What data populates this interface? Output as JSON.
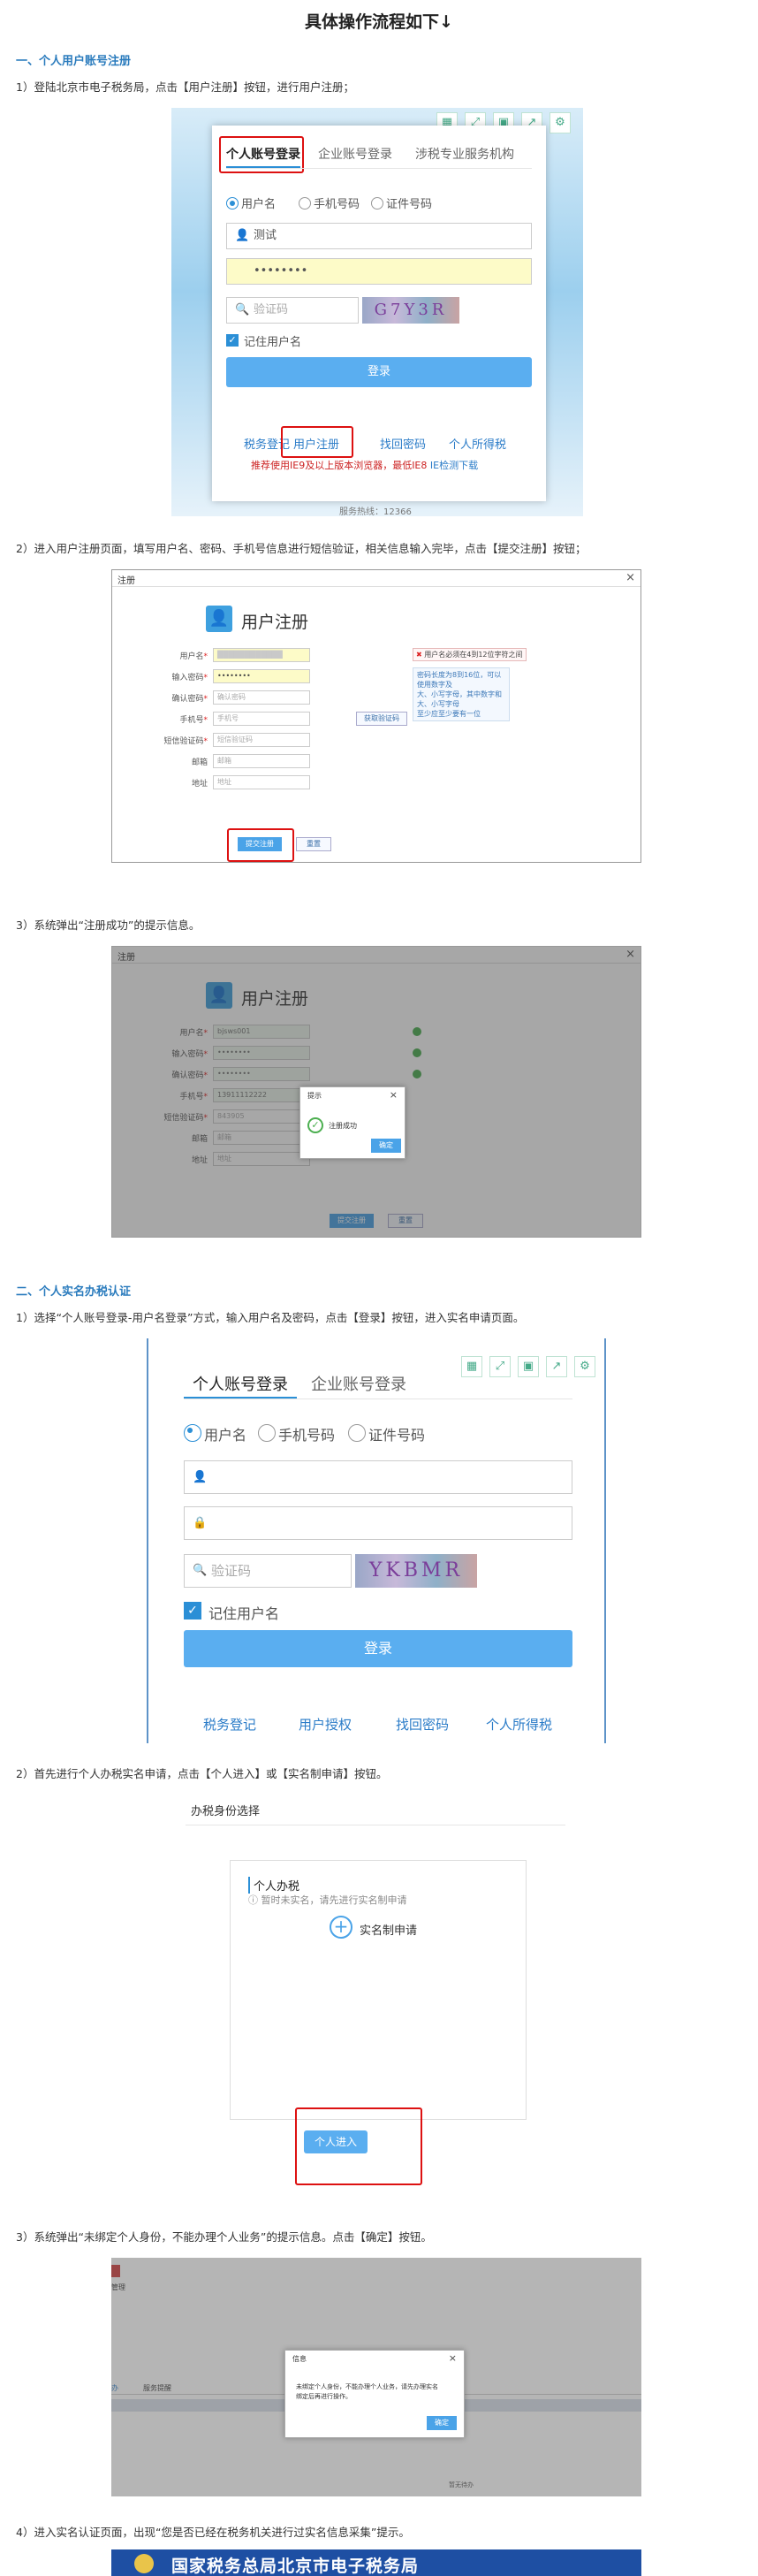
{
  "title": "具体操作流程如下↓",
  "section1": {
    "title": "一、个人用户账号注册",
    "step1": "1）登陆北京市电子税务局，点击【用户注册】按钮，进行用户注册；",
    "step2": "2）进入用户注册页面，填写用户名、密码、手机号信息进行短信验证，相关信息输入完毕，点击【提交注册】按钮；",
    "step3": "3）系统弹出“注册成功”的提示信息。"
  },
  "section2": {
    "title": "二、个人实名办税认证",
    "step1": "1）选择“个人账号登录-用户名登录”方式，输入用户名及密码，点击【登录】按钮，进入实名申请页面。",
    "step2": "2）首先进行个人办税实名申请，点击【个人进入】或【实名制申请】按钮。",
    "step3": "3）系统弹出“未绑定个人身份，不能办理个人业务”的提示信息。点击【确定】按钮。",
    "step4": "4）进入实名认证页面，出现“您是否已经在税务机关进行过实名信息采集”提示。"
  },
  "login": {
    "tabs": [
      "个人账号登录",
      "企业账号登录",
      "涉税专业服务机构"
    ],
    "radios": [
      "用户名",
      "手机号码",
      "证件号码"
    ],
    "username": "测试",
    "password": "••••••••",
    "captcha_placeholder": "验证码",
    "captcha_text1": "G7Y3R",
    "captcha_text2": "YKBMR",
    "remember": "记住用户名",
    "login_button": "登录",
    "links1": [
      "税务登记",
      "用户注册",
      "找回密码",
      "个人所得税"
    ],
    "links2": [
      "税务登记",
      "用户授权",
      "找回密码",
      "个人所得税"
    ],
    "notice_red": "推荐使用IE9及以上版本浏览器，最低IE8",
    "notice_blue": "IE检测下载",
    "bottom_text": "服务热线：12366"
  },
  "register": {
    "dialog_title": "注册",
    "close": "×",
    "heading": "用户注册",
    "labels": [
      "用户名",
      "输入密码",
      "确认密码",
      "手机号",
      "短信验证码",
      "邮箱",
      "地址"
    ],
    "password_value": "••••••••",
    "placeholders": [
      "确认密码",
      "手机号",
      "短信验证码",
      "邮箱",
      "地址"
    ],
    "sms_button": "获取验证码",
    "error_text": "用户名必须在4到12位字符之间",
    "hint_text": [
      "密码长度为8到16位，可以使用数字及",
      "大、小写字母，其中数字和大、小写字母",
      "至少应至少要有一位"
    ],
    "submit": "提交注册",
    "reset": "重置",
    "filled_username": "bjsws001",
    "filled_pwd": "••••••••",
    "filled_phone": "13911112222",
    "filled_sms": "843905"
  },
  "success_popup": {
    "title": "提示",
    "message": "注册成功",
    "ok": "确定"
  },
  "identity": {
    "heading": "办税身份选择",
    "personal": "个人办税",
    "info": "暂时未实名，请先进行实名制申请",
    "apply": "实名制申请",
    "enter": "个人进入"
  },
  "unbound_popup": {
    "title": "信息",
    "message_lines": [
      "未绑定个人身份，不能办理个人业务，请先办理实名",
      "绑定后再进行操作。"
    ],
    "ok": "确定",
    "side_text": "管理",
    "tab_text": "办",
    "tab_text2": "服务提醒",
    "bottom_text": "暂无待办"
  },
  "banner": {
    "text": "国家税务总局北京市电子税务局"
  }
}
